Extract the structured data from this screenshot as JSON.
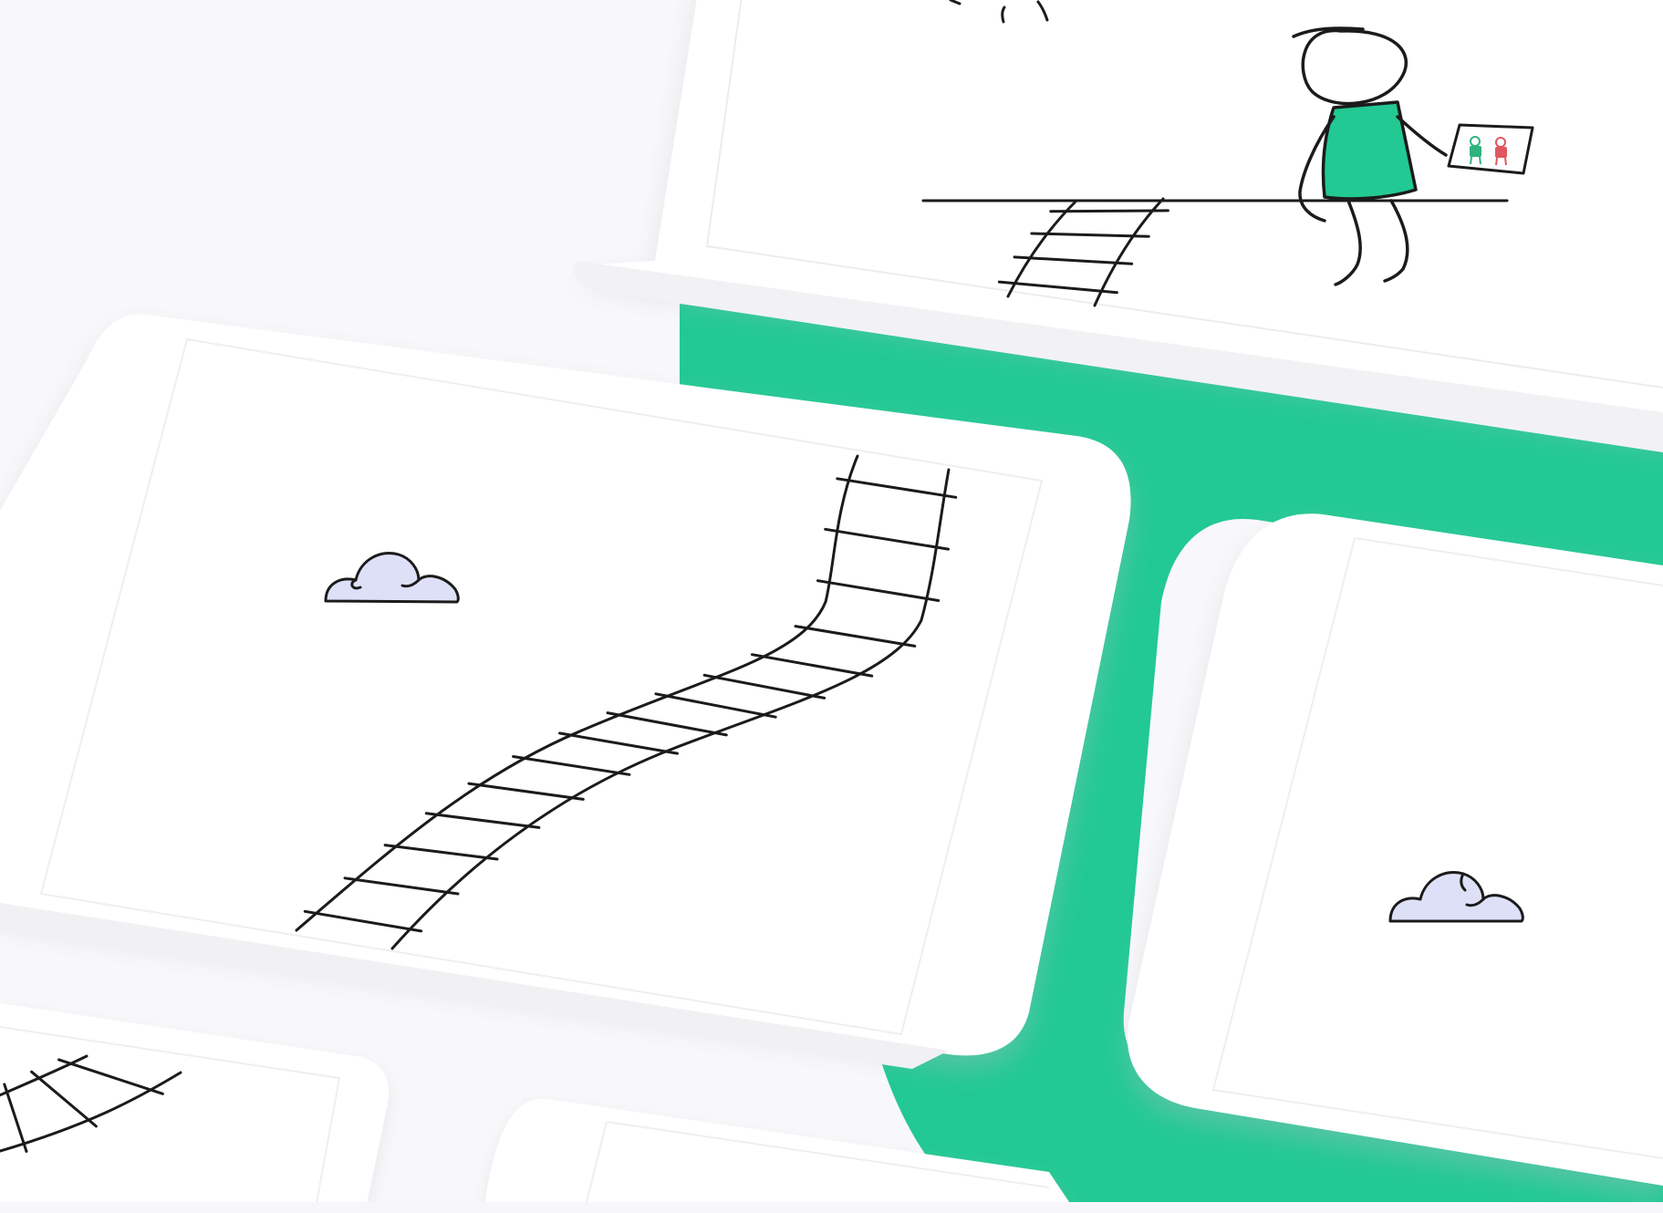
{
  "illustration": {
    "background_color": "#f8f8fa",
    "card_color": "#ffffff",
    "card_edge_color": "#eeeef2",
    "path_color": "#22c993",
    "line_color": "#1b1b1b",
    "cloud_fill": "#dde0f7",
    "figure_shirt_color": "#22c993",
    "drawing_figure_colors": [
      "#2fb37d",
      "#e0575f"
    ],
    "elements": [
      "tilted-screen-cards",
      "green-path",
      "ladder-track",
      "cloud-icon",
      "stick-figure",
      "drawing-frame-icon"
    ]
  }
}
